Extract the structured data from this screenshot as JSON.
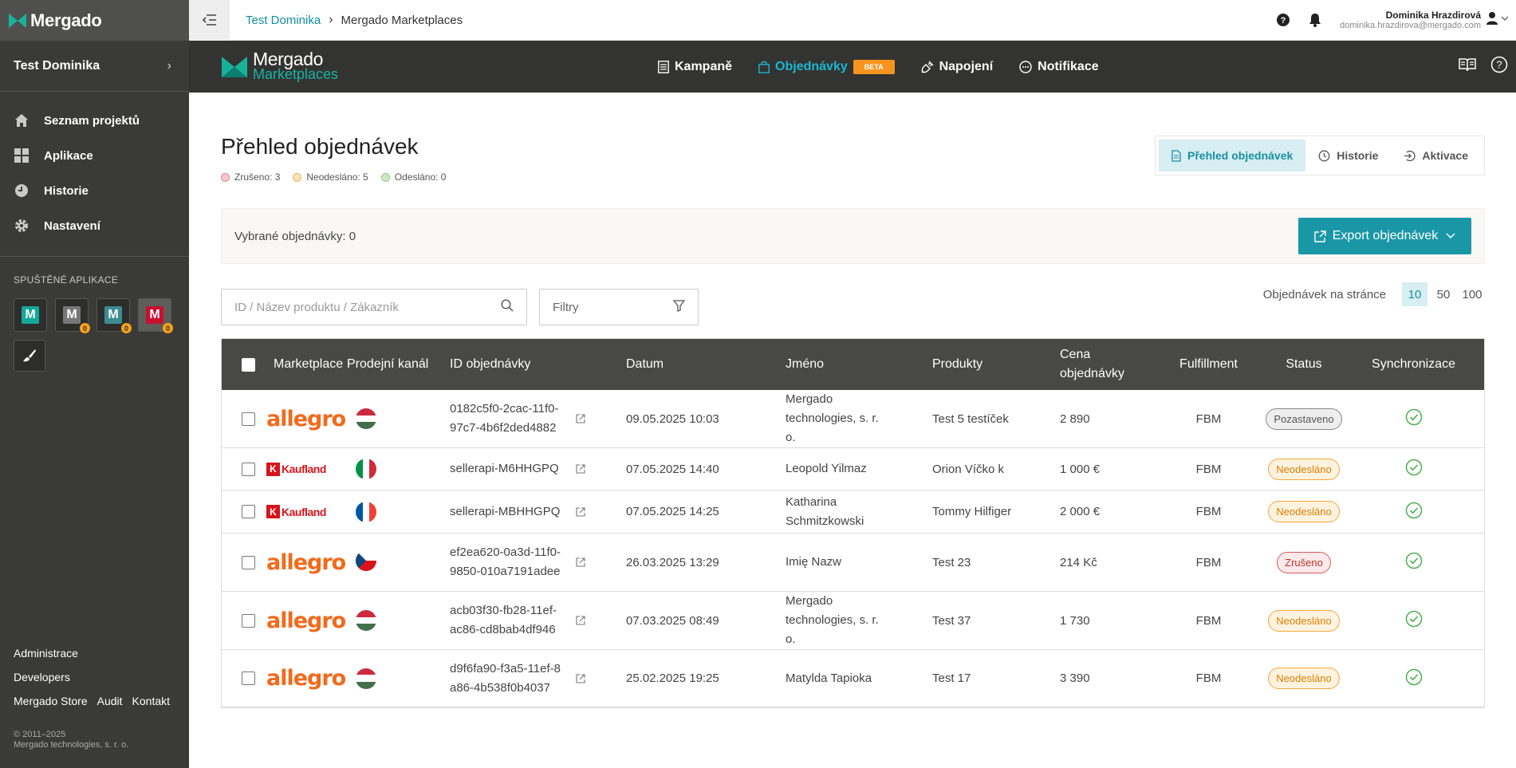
{
  "sidebar": {
    "logo": "Mergado",
    "project": "Test Dominika",
    "nav": [
      "Seznam projektů",
      "Aplikace",
      "Historie",
      "Nastavení"
    ],
    "apps_title": "SPUŠTĚNÉ APLIKACE",
    "apps": [
      {
        "letter": "M",
        "color": "#14a89a",
        "badge": ""
      },
      {
        "letter": "M",
        "color": "#777777",
        "badge": "0"
      },
      {
        "letter": "M",
        "color": "#3c8c92",
        "badge": "0"
      },
      {
        "letter": "M",
        "color": "#c8102e",
        "badge": "0"
      }
    ],
    "footer": {
      "admin": "Administrace",
      "dev": "Developers",
      "store": "Mergado Store",
      "audit": "Audit",
      "contact": "Kontakt",
      "copy1": "© 2011–2025",
      "copy2": "Mergado technologies, s. r. o."
    }
  },
  "topbar": {
    "crumb_project": "Test Dominika",
    "crumb_page": "Mergado Marketplaces",
    "user_name": "Dominika Hrazdirová",
    "user_email": "dominika.hrazdirova@mergado.com"
  },
  "apphead": {
    "logo_1": "Mergado",
    "logo_2": "Marketplaces",
    "nav": {
      "campaigns": "Kampaně",
      "orders": "Objednávky",
      "beta": "BETA",
      "connection": "Napojení",
      "notifications": "Notifikace"
    }
  },
  "page": {
    "title": "Přehled objednávek",
    "legend": {
      "cancelled": "Zrušeno: 3",
      "unsent": "Neodesláno: 5",
      "sent": "Odesláno: 0"
    },
    "tabs": {
      "overview": "Přehled objednávek",
      "history": "Historie",
      "activation": "Aktivace"
    },
    "selected": "Vybrané objednávky: 0",
    "export": "Export objednávek",
    "search_placeholder": "ID / Název produktu / Zákazník",
    "filters": "Filtry",
    "per_page_label": "Objednávek na stránce",
    "per_page": [
      "10",
      "50",
      "100"
    ]
  },
  "table": {
    "headers": {
      "marketplace": "Marketplace",
      "channel": "Prodejní kanál",
      "id": "ID objednávky",
      "date": "Datum",
      "name": "Jméno",
      "products": "Produkty",
      "price": "Cena objednávky",
      "fulfillment": "Fulfillment",
      "status": "Status",
      "sync": "Synchronizace"
    },
    "rows": [
      {
        "mp": "allegro",
        "flag": "hu",
        "id": "0182c5f0-2cac-11f0-97c7-4b6f2ded4882",
        "date": "09.05.2025 10:03",
        "name": "Mergado technologies, s. r. o.",
        "products": "Test 5 testíček",
        "price": "2 890",
        "ff": "FBM",
        "status": "Pozastaveno",
        "st": "paused"
      },
      {
        "mp": "kaufland",
        "flag": "it",
        "id": "sellerapi-M6HHGPQ",
        "date": "07.05.2025 14:40",
        "name": "Leopold Yilmaz",
        "products": "Orion Víčko k",
        "price": "1 000 €",
        "ff": "FBM",
        "status": "Neodesláno",
        "st": "pending"
      },
      {
        "mp": "kaufland",
        "flag": "fr",
        "id": "sellerapi-MBHHGPQ",
        "date": "07.05.2025 14:25",
        "name": "Katharina Schmitzkowski",
        "products": "Tommy Hilfiger",
        "price": "2 000 €",
        "ff": "FBM",
        "status": "Neodesláno",
        "st": "pending"
      },
      {
        "mp": "allegro",
        "flag": "cz",
        "id": "ef2ea620-0a3d-11f0-9850-010a7191adee",
        "date": "26.03.2025 13:29",
        "name": "Imię Nazw",
        "products": "Test 23",
        "price": "214 Kč",
        "ff": "FBM",
        "status": "Zrušeno",
        "st": "cancel"
      },
      {
        "mp": "allegro",
        "flag": "hu",
        "id": "acb03f30-fb28-11ef-ac86-cd8bab4df946",
        "date": "07.03.2025 08:49",
        "name": "Mergado technologies, s. r. o.",
        "products": "Test 37",
        "price": "1 730",
        "ff": "FBM",
        "status": "Neodesláno",
        "st": "pending"
      },
      {
        "mp": "allegro",
        "flag": "hu",
        "id": "d9f6fa90-f3a5-11ef-8a86-4b538f0b4037",
        "date": "25.02.2025 19:25",
        "name": "Matylda Tapioka",
        "products": "Test 17",
        "price": "3 390",
        "ff": "FBM",
        "status": "Neodesláno",
        "st": "pending"
      }
    ]
  },
  "colors": {
    "accent": "#1a97a6",
    "sidebar": "#3a3b38",
    "header": "#333431",
    "allegro": "#f26a1b",
    "kaufland": "#d5151c"
  }
}
